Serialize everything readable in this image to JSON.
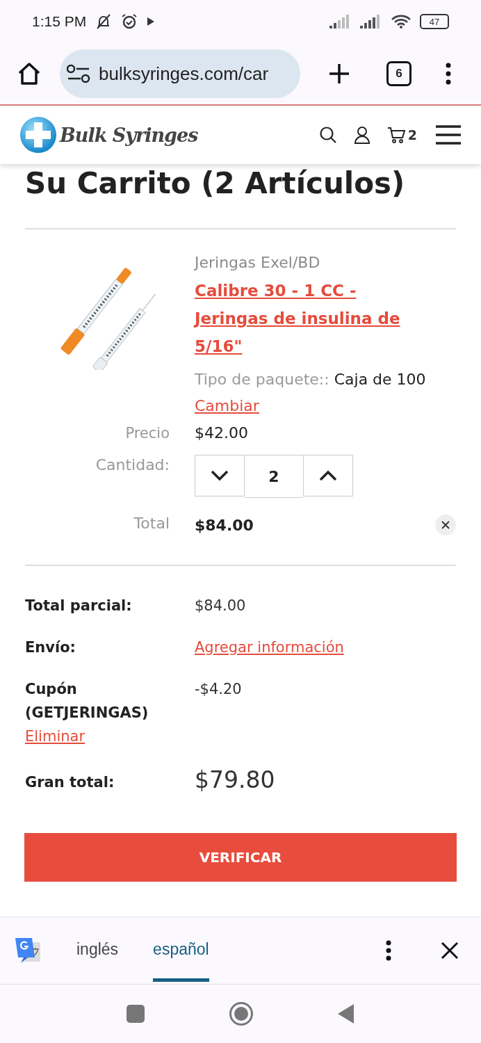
{
  "status_bar": {
    "time": "1:15 PM",
    "battery": "47"
  },
  "browser": {
    "url": "bulksyringes.com/car",
    "tab_count": "6"
  },
  "site_header": {
    "logo": "Bulk Syringes",
    "cart_count": "2"
  },
  "page_title": "Su Carrito (2 Artículos)",
  "cart_item": {
    "brand": "Jeringas Exel/BD",
    "name": "Calibre 30 - 1 CC - Jeringas de insulina de 5/16\"",
    "option_label": "Tipo de paquete::",
    "option_value": "Caja de 100",
    "change_link": "Cambiar",
    "price_label": "Precio",
    "price": "$42.00",
    "quantity_label": "Cantidad:",
    "quantity": "2",
    "total_label": "Total",
    "total": "$84.00"
  },
  "summary": [
    {
      "kind": "text",
      "label": "Total parcial:",
      "value": "$84.00"
    },
    {
      "kind": "link",
      "label": "Envío:",
      "value": "Agregar información"
    },
    {
      "kind": "coupon",
      "label": "Cupón (GETJERINGAS)",
      "action": "Eliminar",
      "value": "-$4.20"
    },
    {
      "kind": "grand",
      "label": "Gran total:",
      "value": "$79.80"
    }
  ],
  "checkout_button": "VERIFICAR",
  "translate_bar": {
    "languages": [
      {
        "label": "inglés",
        "selected": false
      },
      {
        "label": "español",
        "selected": true
      }
    ]
  }
}
